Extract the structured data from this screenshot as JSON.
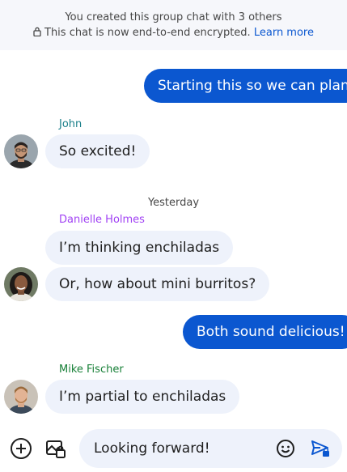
{
  "banner": {
    "line1": "You created this group chat with 3 others",
    "line2": "This chat is now end-to-end encrypted.",
    "learn_more": "Learn more"
  },
  "messages": [
    {
      "text": "Starting this so we can plan"
    },
    {
      "sender": "John",
      "text": "So excited!"
    },
    {
      "day": "Yesterday"
    },
    {
      "sender": "Danielle Holmes",
      "text": "I’m thinking enchiladas"
    },
    {
      "text": "Or, how about mini burritos?"
    },
    {
      "text": "Both sound delicious!"
    },
    {
      "sender": "Mike Fischer",
      "text": "I’m partial to enchiladas"
    }
  ],
  "composer": {
    "input_value": "Looking forward!"
  },
  "colors": {
    "accent": "#0b57d0",
    "incoming_bubble": "#eef2fb",
    "john": "#1a7f8a",
    "danielle": "#a142f4",
    "mike": "#188038"
  },
  "icons": [
    "lock-icon",
    "add-icon",
    "gallery-icon",
    "emoji-icon",
    "send-encrypted-icon"
  ]
}
